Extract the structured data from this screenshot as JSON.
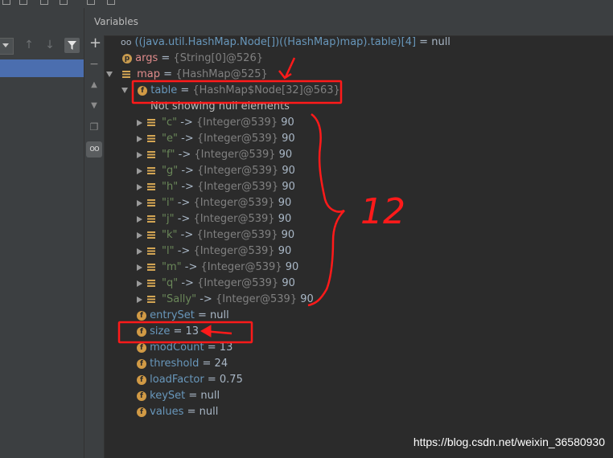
{
  "panel": {
    "title": "Variables"
  },
  "watch_row": {
    "expression": "((java.util.HashMap.Node[])((HashMap)map).table)[4]",
    "op": " = ",
    "value": "null"
  },
  "args_row": {
    "name": "args",
    "op": " = ",
    "ref": "{String[0]@526}"
  },
  "map_row": {
    "name": "map",
    "op": " = ",
    "ref": "{HashMap@525}"
  },
  "table_row": {
    "name": "table",
    "op": " = ",
    "ref": "{HashMap$Node[32]@563}"
  },
  "null_note": "Not showing null elements",
  "entries": [
    {
      "key": "\"c\"",
      "arrow": " -> ",
      "ref": "{Integer@539}",
      "value": " 90"
    },
    {
      "key": "\"e\"",
      "arrow": " -> ",
      "ref": "{Integer@539}",
      "value": " 90"
    },
    {
      "key": "\"f\"",
      "arrow": " -> ",
      "ref": "{Integer@539}",
      "value": " 90"
    },
    {
      "key": "\"g\"",
      "arrow": " -> ",
      "ref": "{Integer@539}",
      "value": " 90"
    },
    {
      "key": "\"h\"",
      "arrow": " -> ",
      "ref": "{Integer@539}",
      "value": " 90"
    },
    {
      "key": "\"i\"",
      "arrow": " -> ",
      "ref": "{Integer@539}",
      "value": " 90"
    },
    {
      "key": "\"j\"",
      "arrow": " -> ",
      "ref": "{Integer@539}",
      "value": " 90"
    },
    {
      "key": "\"k\"",
      "arrow": " -> ",
      "ref": "{Integer@539}",
      "value": " 90"
    },
    {
      "key": "\"l\"",
      "arrow": " -> ",
      "ref": "{Integer@539}",
      "value": " 90"
    },
    {
      "key": "\"m\"",
      "arrow": " -> ",
      "ref": "{Integer@539}",
      "value": " 90"
    },
    {
      "key": "\"q\"",
      "arrow": " -> ",
      "ref": "{Integer@539}",
      "value": " 90"
    },
    {
      "key": "\"Sally\"",
      "arrow": " -> ",
      "ref": "{Integer@539}",
      "value": " 90"
    }
  ],
  "fields": [
    {
      "name": "entrySet",
      "op": " = ",
      "value": "null"
    },
    {
      "name": "size",
      "op": " = ",
      "value": "13"
    },
    {
      "name": "modCount",
      "op": " = ",
      "value": "13"
    },
    {
      "name": "threshold",
      "op": " = ",
      "value": "24"
    },
    {
      "name": "loadFactor",
      "op": " = ",
      "value": "0.75"
    },
    {
      "name": "keySet",
      "op": " = ",
      "value": "null"
    },
    {
      "name": "values",
      "op": " = ",
      "value": "null"
    }
  ],
  "badges": {
    "field": "f",
    "param": "p"
  },
  "annotation": {
    "count_label": "12",
    "color": "#ff1a1a"
  },
  "watermark": "https://blog.csdn.net/weixin_36580930",
  "icons": [
    "glasses-icon",
    "lines-icon",
    "filter-icon",
    "up-arrow-icon",
    "down-arrow-icon",
    "plus-icon",
    "copy-icon",
    "expand-triangle-icon",
    "collapse-triangle-icon"
  ]
}
